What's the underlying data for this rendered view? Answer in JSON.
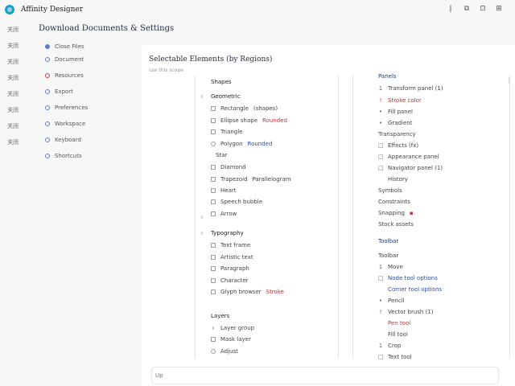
{
  "window": {
    "title": "Affinity Designer",
    "controls": [
      "ǀ",
      "⧉",
      "⊡",
      "⊞"
    ]
  },
  "rail": [
    "关闭",
    "关闭",
    "关闭",
    "关闭",
    "关闭",
    "关闭",
    "关闭",
    "关闭"
  ],
  "sidebar": {
    "items": [
      "Close Files",
      "Document",
      "Resources",
      "Export",
      "Preferences",
      "Workspace",
      "Keyboard",
      "Shortcuts"
    ]
  },
  "heading": "Download Documents & Settings",
  "main": {
    "title": "Selectable Elements (by Regions)",
    "subtitle": "use this scope",
    "col1": {
      "section1": {
        "head": "Shapes",
        "sub": "Geometric",
        "rows": [
          {
            "prefix": "Rectangle",
            "suffix": "(shapes)",
            "color": ""
          },
          {
            "prefix": "Ellipse shape",
            "suffix": "Rounded",
            "color": "red"
          },
          {
            "prefix": "Triangle",
            "suffix": "",
            "color": ""
          },
          {
            "prefix": "Polygon",
            "suffix": "Rounded",
            "color": "blue"
          },
          {
            "prefix": "Star",
            "suffix": "",
            "color": ""
          },
          {
            "prefix": "Diamond",
            "suffix": "",
            "color": ""
          },
          {
            "prefix": "Trapezoid",
            "suffix": "Parallelogram",
            "color": ""
          },
          {
            "prefix": "Heart",
            "suffix": "",
            "color": ""
          },
          {
            "prefix": "Speech bubble",
            "suffix": "",
            "color": ""
          },
          {
            "prefix": "Arrow",
            "suffix": "",
            "color": ""
          }
        ]
      },
      "section2": {
        "head": "Typography",
        "rows": [
          {
            "prefix": "Text frame",
            "suffix": "",
            "color": ""
          },
          {
            "prefix": "Artistic text",
            "suffix": "",
            "color": ""
          },
          {
            "prefix": "Paragraph",
            "suffix": "",
            "color": ""
          },
          {
            "prefix": "Character",
            "suffix": "",
            "color": ""
          },
          {
            "prefix": "Glyph browser",
            "suffix": "Stroke",
            "color": "red"
          }
        ]
      },
      "section3": {
        "head": "Layers",
        "rows": [
          {
            "prefix": "Layer group",
            "suffix": "",
            "color": ""
          },
          {
            "prefix": "Mask layer",
            "suffix": "",
            "color": ""
          },
          {
            "prefix": "Adjust",
            "suffix": "",
            "color": ""
          }
        ]
      }
    },
    "col2": {
      "section1": {
        "head": "Panels",
        "rows": [
          {
            "mark": "1",
            "text": "Transform panel (1)",
            "color": ""
          },
          {
            "mark": "!",
            "text": "Stroke color",
            "color": "red"
          },
          {
            "mark": "•",
            "text": "Fill panel",
            "color": ""
          },
          {
            "mark": "•",
            "text": "Gradient",
            "color": ""
          },
          {
            "mark": "",
            "text": "Transparency",
            "color": ""
          },
          {
            "mark": "□",
            "text": "Effects (fx)",
            "color": ""
          },
          {
            "mark": "□",
            "text": "Appearance panel",
            "color": ""
          },
          {
            "mark": "□",
            "text": "Navigator panel (1)",
            "color": ""
          },
          {
            "mark": "",
            "text": "History",
            "color": ""
          },
          {
            "mark": "",
            "text": "Symbols",
            "color": ""
          },
          {
            "mark": "",
            "text": "Constraints",
            "color": ""
          },
          {
            "mark": "",
            "text": "Snapping",
            "color": "red"
          },
          {
            "mark": "",
            "text": "Stock assets",
            "color": ""
          }
        ]
      },
      "section2": {
        "head": "Toolbar",
        "rows": [
          {
            "mark": "",
            "text": "Toolbar",
            "color": ""
          },
          {
            "mark": "1",
            "text": "Move",
            "color": ""
          },
          {
            "mark": "□",
            "text": "Node tool options",
            "color": "blue"
          },
          {
            "mark": "",
            "text": "Corner tool options",
            "color": "blue"
          },
          {
            "mark": "•",
            "text": "Pencil",
            "color": ""
          },
          {
            "mark": "!",
            "text": "Vector brush (1)",
            "color": ""
          },
          {
            "mark": "",
            "text": "Pen tool",
            "color": "red"
          },
          {
            "mark": "",
            "text": "Fill tool",
            "color": ""
          },
          {
            "mark": "1",
            "text": "Crop",
            "color": ""
          },
          {
            "mark": "□",
            "text": "Text tool",
            "color": ""
          }
        ]
      }
    }
  },
  "chat": {
    "placeholder": "Up"
  },
  "colors": {
    "accent": "#18a0c8",
    "red": "#c43030",
    "blue": "#2c4d9a"
  }
}
